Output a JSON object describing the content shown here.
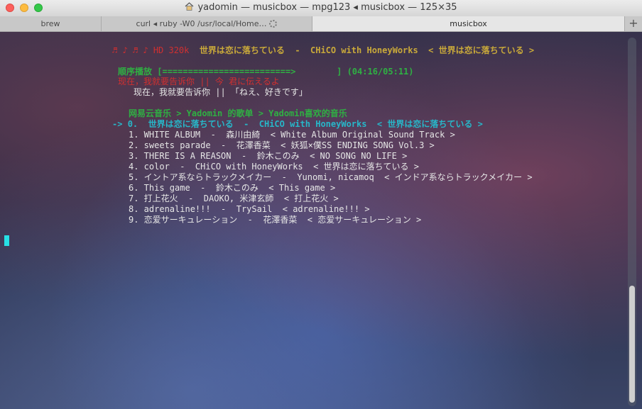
{
  "window": {
    "title": "yadomin — musicbox — mpg123 ◂ musicbox — 125×35"
  },
  "tabs": [
    {
      "label": "brew"
    },
    {
      "label": "curl ◂ ruby -W0 /usr/local/Home…"
    },
    {
      "label": "musicbox"
    }
  ],
  "colors": {
    "red": "#d03030",
    "yellow": "#c9a93a",
    "green": "#2fb043",
    "cyan": "#27b7c9",
    "white": "#e6e6e6"
  },
  "player": {
    "now_playing": {
      "notes": "♬ ♪ ♬ ♪",
      "quality": "HD 320k",
      "song": "世界は恋に落ちている",
      "artist": "CHiCO with HoneyWorks",
      "album": "< 世界は恋に落ちている >"
    },
    "mode": "顺序播放",
    "progress_bar": "[=========================>        ]",
    "progress_percent": 75,
    "time": "(04:16/05:11)",
    "lyric_current": "现在，我就要告诉你 || 今 君に伝えるよ",
    "lyric_translation": "现在，我就要告诉你 || 「ねえ、好きです」",
    "breadcrumb": "网易云音乐 > Yadomin 的歌单 > Yadomin喜欢的音乐",
    "selected": {
      "pointer": "->",
      "index": "0.",
      "song": "世界は恋に落ちている",
      "artist": "CHiCO with HoneyWorks",
      "album": "< 世界は恋に落ちている >"
    },
    "tracks": [
      "1. WHITE ALBUM  -  森川由綺  < White Album Original Sound Track >",
      "2. sweets parade  -  花澤香菜  < 妖狐×僕SS ENDING SONG Vol.3 >",
      "3. THERE IS A REASON  -  鈴木このみ  < NO SONG NO LIFE >",
      "4. color  -  CHiCO with HoneyWorks  < 世界は恋に落ちている >",
      "5. イントア系ならトラックメイカー  -  Yunomi, nicamoq  < インドア系ならトラックメイカー >",
      "6. This game  -  鈴木このみ  < This game >",
      "7. 打上花火  -  DAOKO, 米津玄師  < 打上花火 >",
      "8. adrenaline!!!  -  TrySail  < adrenaline!!! >",
      "9. 恋爱サーキュレーション  -  花澤香菜  < 恋爱サーキュレーション >"
    ]
  },
  "scrollbar": {
    "position_percent": 100
  }
}
